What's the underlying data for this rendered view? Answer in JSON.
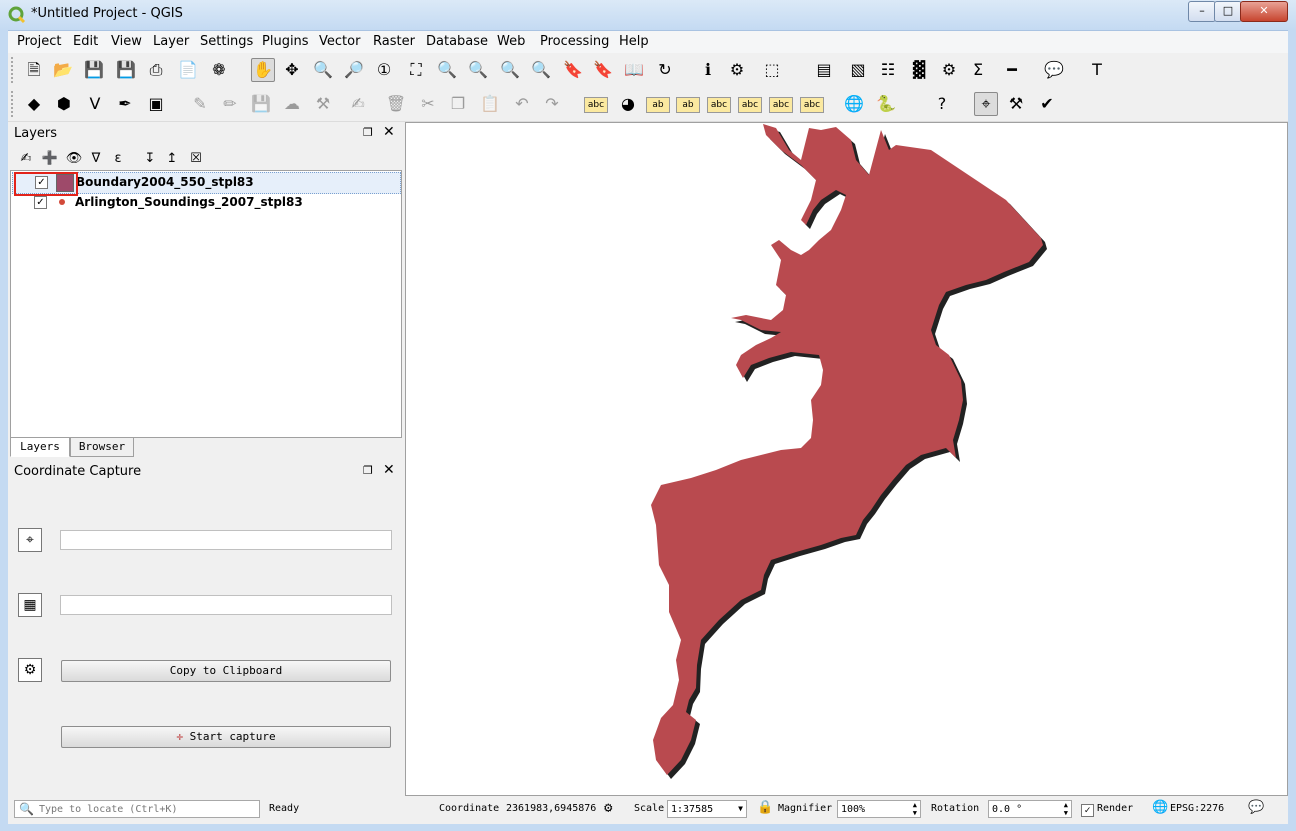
{
  "window": {
    "title": "*Untitled Project - QGIS",
    "minimize": "–",
    "maximize": "□",
    "close": "✕"
  },
  "menubar": [
    "Project",
    "Edit",
    "View",
    "Layer",
    "Settings",
    "Plugins",
    "Vector",
    "Raster",
    "Database",
    "Web",
    "Processing",
    "Help"
  ],
  "toolbar1": [
    {
      "name": "new-project-icon",
      "glyph": "🗎"
    },
    {
      "name": "open-project-icon",
      "glyph": "📂"
    },
    {
      "name": "save-project-icon",
      "glyph": "💾"
    },
    {
      "name": "save-as-icon",
      "glyph": "💾"
    },
    {
      "name": "new-print-composer-icon",
      "glyph": "⎙"
    },
    {
      "name": "composer-manager-icon",
      "glyph": "📄"
    },
    {
      "name": "style-manager-icon",
      "glyph": "❁"
    },
    {
      "name": "pan-icon",
      "glyph": "✋"
    },
    {
      "name": "pan-to-selection-icon",
      "glyph": "✥"
    },
    {
      "name": "zoom-in-icon",
      "glyph": "🔍"
    },
    {
      "name": "zoom-out-icon",
      "glyph": "🔎"
    },
    {
      "name": "zoom-native-icon",
      "glyph": "①"
    },
    {
      "name": "zoom-full-icon",
      "glyph": "⛶"
    },
    {
      "name": "zoom-selection-icon",
      "glyph": "🔍"
    },
    {
      "name": "zoom-layer-icon",
      "glyph": "🔍"
    },
    {
      "name": "zoom-last-icon",
      "glyph": "🔍"
    },
    {
      "name": "zoom-next-icon",
      "glyph": "🔍"
    },
    {
      "name": "new-bookmark-icon",
      "glyph": "🔖"
    },
    {
      "name": "show-bookmarks-icon",
      "glyph": "🔖"
    },
    {
      "name": "tile-scale-icon",
      "glyph": "📖"
    },
    {
      "name": "refresh-icon",
      "glyph": "↻"
    },
    {
      "name": "identify-icon",
      "glyph": "ℹ"
    },
    {
      "name": "run-action-icon",
      "glyph": "⚙"
    },
    {
      "name": "select-features-icon",
      "glyph": "⬚"
    },
    {
      "name": "select-value-icon",
      "glyph": "▤"
    },
    {
      "name": "deselect-icon",
      "glyph": "▧"
    },
    {
      "name": "attribute-table-icon",
      "glyph": "☷"
    },
    {
      "name": "field-calculator-icon",
      "glyph": "▓"
    },
    {
      "name": "settings-gear-icon",
      "glyph": "⚙"
    },
    {
      "name": "statistics-sum-icon",
      "glyph": "Σ"
    },
    {
      "name": "measure-icon",
      "glyph": "━"
    },
    {
      "name": "map-tips-icon",
      "glyph": "💬"
    },
    {
      "name": "text-annotation-icon",
      "glyph": "T"
    }
  ],
  "toolbar2": [
    {
      "name": "add-vector-layer-icon",
      "glyph": "◆"
    },
    {
      "name": "add-spatialite-icon",
      "glyph": "⬢"
    },
    {
      "name": "add-delimited-text-icon",
      "glyph": "V"
    },
    {
      "name": "add-wms-icon",
      "glyph": "✒"
    },
    {
      "name": "add-wcs-icon",
      "glyph": "▣"
    },
    {
      "name": "current-edits-icon",
      "glyph": "✎"
    },
    {
      "name": "toggle-editing-icon",
      "glyph": "✏"
    },
    {
      "name": "save-layer-edits-icon",
      "glyph": "💾"
    },
    {
      "name": "add-feature-icon",
      "glyph": "☁"
    },
    {
      "name": "node-tool-icon",
      "glyph": "⚒"
    },
    {
      "name": "modify-attributes-icon",
      "glyph": "✍"
    },
    {
      "name": "delete-selected-icon",
      "glyph": "🗑"
    },
    {
      "name": "cut-features-icon",
      "glyph": "✂"
    },
    {
      "name": "copy-features-icon",
      "glyph": "❐"
    },
    {
      "name": "paste-features-icon",
      "glyph": "📋"
    },
    {
      "name": "undo-icon",
      "glyph": "↶"
    },
    {
      "name": "redo-icon",
      "glyph": "↷"
    },
    {
      "name": "layer-labeling-icon",
      "glyph": "abc"
    },
    {
      "name": "layer-diagram-icon",
      "glyph": "◕"
    },
    {
      "name": "highlight-pinned-labels-icon",
      "glyph": "ab"
    },
    {
      "name": "pin-labels-icon",
      "glyph": "ab"
    },
    {
      "name": "show-hide-labels-icon",
      "glyph": "abc"
    },
    {
      "name": "move-label-icon",
      "glyph": "abc"
    },
    {
      "name": "rotate-label-icon",
      "glyph": "abc"
    },
    {
      "name": "change-label-icon",
      "glyph": "abc"
    },
    {
      "name": "globe-icon",
      "glyph": "🌐"
    },
    {
      "name": "python-console-icon",
      "glyph": "🐍"
    },
    {
      "name": "help-icon",
      "glyph": "?"
    },
    {
      "name": "coordinate-capture-icon",
      "glyph": "⌖"
    },
    {
      "name": "plugin-tool-icon",
      "glyph": "⚒"
    },
    {
      "name": "check-geometry-icon",
      "glyph": "✔"
    }
  ],
  "layers_panel": {
    "title": "Layers",
    "float": "❐",
    "close": "✕",
    "tools": [
      {
        "name": "open-layer-styling-icon",
        "glyph": "✍"
      },
      {
        "name": "add-group-icon",
        "glyph": "➕"
      },
      {
        "name": "manage-visibility-icon",
        "glyph": "👁"
      },
      {
        "name": "filter-legend-icon",
        "glyph": "∇"
      },
      {
        "name": "filter-expression-icon",
        "glyph": "ε"
      },
      {
        "name": "expand-all-icon",
        "glyph": "↧"
      },
      {
        "name": "collapse-all-icon",
        "glyph": "↥"
      },
      {
        "name": "remove-layer-icon",
        "glyph": "☒"
      }
    ],
    "layers": [
      {
        "label": "Boundary2004_550_stpl83",
        "checked": "✓",
        "color": "#9e4a6a"
      },
      {
        "label": "Arlington_Soundings_2007_stpl83",
        "checked": "✓",
        "color": "#d24a3a"
      }
    ],
    "tabs": [
      "Layers",
      "Browser"
    ]
  },
  "coordinate_capture": {
    "title": "Coordinate Capture",
    "float": "❐",
    "close": "✕",
    "crs_icon": "⌖",
    "grid_icon": "▦",
    "track_icon": "⚙",
    "field1_value": "",
    "field2_value": "",
    "copy_button": "Copy to Clipboard",
    "start_button": "Start capture",
    "start_icon": "✛"
  },
  "map": {
    "fill_color": "#b94a4f",
    "shadow_color": "#222222",
    "background": "#ffffff"
  },
  "statusbar": {
    "locate_placeholder": "Type to locate (Ctrl+K)",
    "status": "Ready",
    "coordinate_label": "Coordinate",
    "coordinate_value": "2361983,6945876",
    "scale_label": "Scale",
    "scale_value": "1:37585",
    "magnifier_label": "Magnifier",
    "magnifier_value": "100%",
    "rotation_label": "Rotation",
    "rotation_value": "0.0 °",
    "render_label": "Render",
    "render_checked": "✓",
    "crs": "EPSG:2276"
  }
}
